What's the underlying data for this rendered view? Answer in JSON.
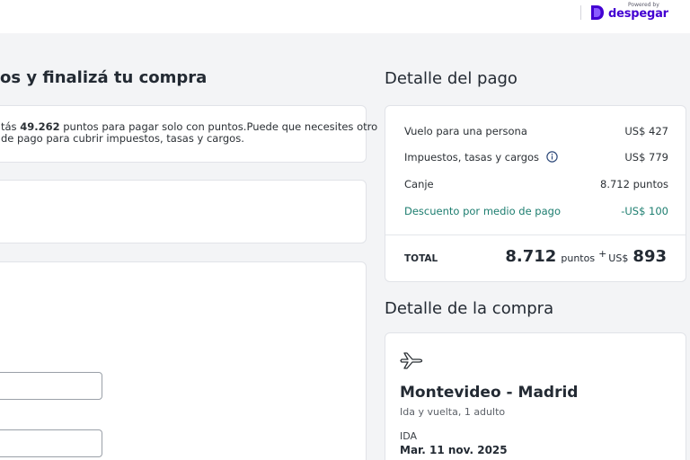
{
  "brand": {
    "powered_by": "Powered by",
    "name": "despegar",
    "color": "#4300d2"
  },
  "left": {
    "title": "os y finalizá tu compra",
    "info": {
      "prefix": "tás ",
      "points": "49.262",
      "line1_rest": " puntos para pagar solo con puntos.Puede que necesites otro",
      "line2": "de pago para cubrir impuestos, tasas y cargos."
    }
  },
  "payment": {
    "title": "Detalle del pago",
    "rows": [
      {
        "label": "Vuelo para una persona",
        "value": "US$ 427"
      },
      {
        "label": "Impuestos, tasas y cargos",
        "value": "US$ 779",
        "icon": "info-circle-icon"
      },
      {
        "label": "Canje",
        "value": "8.712 puntos"
      },
      {
        "label": "Descuento por medio de pago",
        "value": "-US$ 100",
        "color": "#1c7d6f"
      }
    ],
    "total": {
      "label": "TOTAL",
      "points": "8.712",
      "points_unit": "puntos",
      "plus": "+",
      "currency": "US$",
      "amount": "893"
    }
  },
  "purchase": {
    "title": "Detalle de la compra",
    "icon": "airplane-icon",
    "route": "Montevideo - Madrid",
    "subtitle": "Ida y vuelta, 1 adulto",
    "leg_label": "IDA",
    "leg_date": "Mar. 11 nov. 2025"
  }
}
